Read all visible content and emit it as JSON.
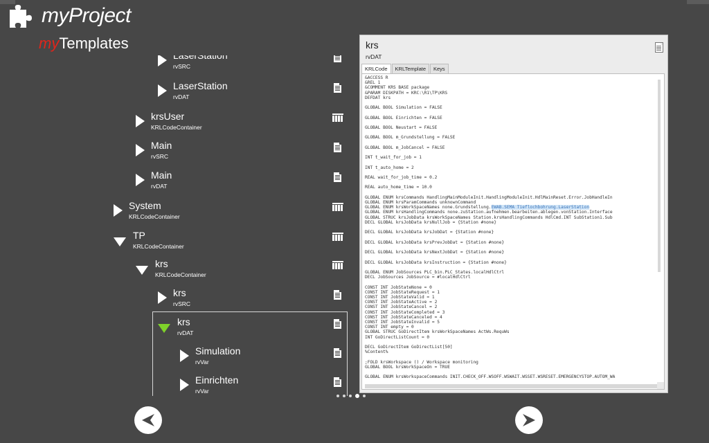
{
  "app": {
    "title": "myProject",
    "subtitle_prefix": "my",
    "subtitle": "Templates"
  },
  "tree": [
    {
      "label": "LaserStation",
      "type": "rvSRC",
      "icon": "doc-icon",
      "expanded": false
    },
    {
      "label": "LaserStation",
      "type": "rvDAT",
      "icon": "doc-icon",
      "expanded": false
    },
    {
      "label": "krsUser",
      "type": "KRLCodeContainer",
      "icon": "container-icon",
      "expanded": false
    },
    {
      "label": "Main",
      "type": "rvSRC",
      "icon": "doc-icon",
      "expanded": false
    },
    {
      "label": "Main",
      "type": "rvDAT",
      "icon": "doc-icon",
      "expanded": false
    },
    {
      "label": "System",
      "type": "KRLCodeContainer",
      "icon": "container-icon",
      "expanded": false
    },
    {
      "label": "TP",
      "type": "KRLCodeContainer",
      "icon": "container-icon",
      "expanded": true
    },
    {
      "label": "krs",
      "type": "KRLCodeContainer",
      "icon": "container-icon",
      "expanded": true
    },
    {
      "label": "krs",
      "type": "rvSRC",
      "icon": "doc-icon",
      "expanded": false
    },
    {
      "label": "krs",
      "type": "rvDAT",
      "icon": "doc-icon",
      "expanded": true,
      "selected": true
    },
    {
      "label": "Simulation",
      "type": "rvVar",
      "icon": "doc-icon",
      "expanded": false
    },
    {
      "label": "Einrichten",
      "type": "rvVar",
      "icon": "doc-icon",
      "expanded": false
    }
  ],
  "panel": {
    "title": "krs",
    "subtitle": "rvDAT",
    "tabs": [
      "KRLCode",
      "KRLTemplate",
      "Keys"
    ],
    "active_tab": "KRLCode",
    "code_before": "&ACCESS R\n&REL 1\n&COMMENT KRS BASE package\n&PARAM DISKPATH = KRC:\\R1\\TP\\KRS\nDEFDAT krs\n\nGLOBAL BOOL Simulation = FALSE\n\nGLOBAL BOOL Einrichten = FALSE\n\nGLOBAL BOOL Neustart = FALSE\n\nGLOBAL BOOL m_Grundstellung = FALSE\n\nGLOBAL BOOL m_JobCancel = FALSE\n\nINT t_wait_for_job = 1\n\nINT t_auto_home = 2\n\nREAL wait_for_job_time = 0.2\n\nREAL auto_home_time = 10.0\n\nGLOBAL ENUM krsCommands HandlingMainModuleInit.HandlingModuleInit.HdlMainReset.Error.JobHandleIn\nGLOBAL ENUM krsParamCommands unknownCommand\nGLOBAL ENUM krsWorkSpaceNames none.Grundstellung.",
    "code_highlight": "EWAB.SEMA Tieflochbohrung.LaserStation",
    "code_after": "\nGLOBAL ENUM krsHandlingCommands none.zuStation.aufnehmen.bearbeiten.ablegen.vonStation.Interface\nGLOBAL STRUC krsJobData krsWorkSpaceNames Station.krsHandlingCommands HdlCmd.INT SubStation1.Sub\nDECL GLOBAL krsJobData krsNullJob = {Station #none}\n\nDECL GLOBAL krsJobData krsJobDat = {Station #none}\n\nDECL GLOBAL krsJobData krsPrevJobDat = {Station #none}\n\nDECL GLOBAL krsJobData krsNextJobDat = {Station #none}\n\nDECL GLOBAL krsJobData krsInstruction = {Station #none}\n\nGLOBAL ENUM JobSources PLC_bin.PLC_States.localHdlCtrl\nDECL JobSources JobSource = #localHdlCtrl\n\nCONST INT JobStateNone = 0\nCONST INT JobStateRequest = 1\nCONST INT JobStateValid = 1\nCONST INT JobStateActive = 2\nCONST INT JobStateCancel = 2\nCONST INT JobStateCompleted = 3\nCONST INT JobStateCanceled = 4\nCONST INT JobStateInvalid = 5\nCONST INT empty = 0\nGLOBAL STRUC GoDirectItem krsWorkSpaceNames ActWs.RequWs\nINT GoDirectListCount = 0\n\nDECL GoDirectItem GoDirectList[50]\n%Content%\n\n;FOLD krsWorkspace () / Workspace monitoring\nGLOBAL BOOL krsWorkSpaceOn = TRUE\n\nGLOBAL ENUM krsWorkspaceCommands INIT.CHECK_OFF.WSOFF.WSWAIT.WSSET.WSRESET.EMERGENCYSTOP.AUTOM_WA"
  },
  "pager": {
    "count": 5,
    "active": 3
  },
  "nav": {
    "back": "back",
    "forward": "forward"
  }
}
